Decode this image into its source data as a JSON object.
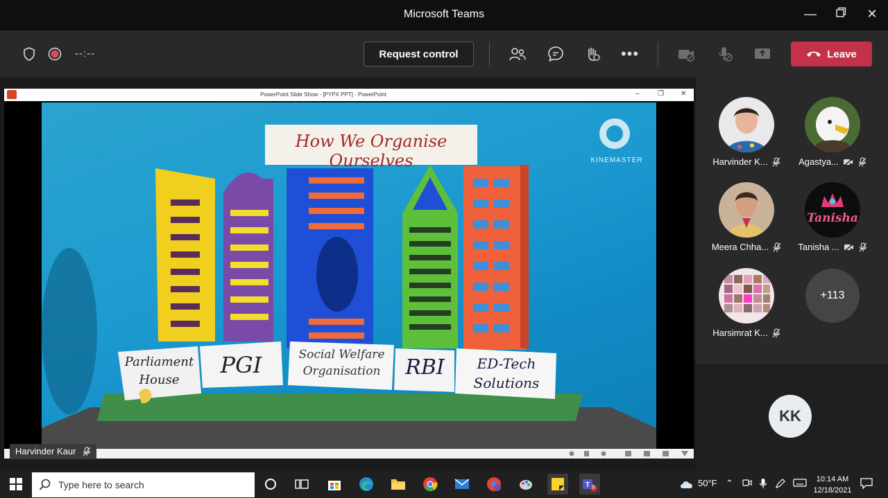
{
  "window": {
    "title": "Microsoft Teams"
  },
  "toolbar": {
    "timer": "--:--",
    "request_control": "Request control",
    "leave": "Leave"
  },
  "share": {
    "ppt_title": "PowerPoint Slide Show - [PYPX PPT] - PowerPoint",
    "presenter": "Harvinder Kaur",
    "slide": {
      "heading": "How We Organise Ourselves",
      "watermark": "KINEMASTER",
      "labels": [
        "Parliament House",
        "PGI",
        "Social Welfare Organisation",
        "RBI",
        "ED-Tech Solutions"
      ]
    }
  },
  "participants": [
    {
      "name": "Harvinder K...",
      "avatar": "photo-woman"
    },
    {
      "name": "Agastya...",
      "avatar": "eagle"
    },
    {
      "name": "Meera Chha...",
      "avatar": "photo-woman-2"
    },
    {
      "name": "Tanisha ...",
      "avatar": "tanisha-logo",
      "avatar_text": "Tanisha"
    },
    {
      "name": "Harsimrat K...",
      "avatar": "collage"
    }
  ],
  "overflow_count": "+113",
  "self_initials": "KK",
  "taskbar": {
    "search_placeholder": "Type here to search",
    "weather": "50°F",
    "time": "10:14 AM",
    "date": "12/18/2021",
    "teams_badge": "9"
  },
  "colors": {
    "leave": "#c4314b",
    "toolbar": "#292929",
    "titlebar": "#0f0f0f",
    "taskbar": "#202020"
  }
}
